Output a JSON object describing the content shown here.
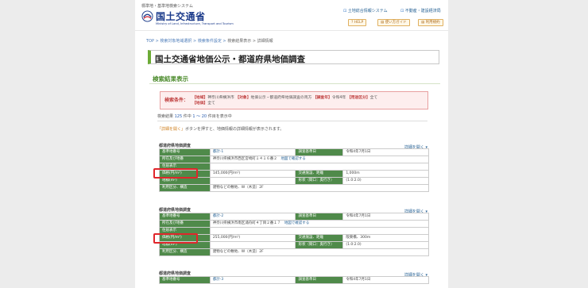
{
  "header": {
    "system_name": "標準地・基準地検索システム",
    "logo_ja": "国土交通省",
    "logo_en": "Ministry of Land, Infrastructure, Transport and Tourism",
    "links": [
      "土地総合情報システム",
      "不動産・建設経済局"
    ],
    "buttons": [
      "HELP",
      "使い方ガイド",
      "利用規約"
    ]
  },
  "breadcrumb": {
    "items": [
      "TOP",
      "検索対象地域選択",
      "検索条件設定",
      "検索結果表示"
    ],
    "current": "詳細情報",
    "separator": ">"
  },
  "page_title": "国土交通省地価公示・都道府県地価調査",
  "section_title": "検索結果表示",
  "search_condition": {
    "label": "検索条件：",
    "region_tag": "【地域】",
    "region": "神奈川県横浜市",
    "target_tag": "【対象】",
    "target": "地価公示・都道府県地価調査の両方",
    "year_tag": "【調査年】",
    "year": "令和4年",
    "use_tag": "【用途区分】",
    "use": "全て",
    "area_tag": "【地価】",
    "area": "全て"
  },
  "results": {
    "prefix": "検索結果",
    "total": "125",
    "mid": "件中",
    "range": "1 ～ 20",
    "suffix": "件目を表示中"
  },
  "note": {
    "button_label": "「詳細を開く」",
    "text": "ボタンを押すと、地価情報の詳細情報が表示されます。"
  },
  "records": [
    {
      "heading": "都道府県地価調査",
      "detail_link": "詳細を開く",
      "number_label": "基準地番号",
      "number": "都計-1",
      "date_label": "調査基準日",
      "date": "令和4年7月1日",
      "location_label": "所在及び地番",
      "location": "神奈川県横浜市西区宮崎町１４１６番２",
      "map_link": "地図で確認する",
      "residence_label": "住居表示",
      "residence": "",
      "price_label": "価格(円/m²)",
      "price": "145,000(円/m²)",
      "access_label": "交通施設、距離",
      "access": "1,000m",
      "area_label": "地積(m²)",
      "area": "",
      "zone_label": "形状（間口：奥行き）",
      "zone": "(1.0:2.0)",
      "use_label": "利用区分、構造",
      "use": "建物などの敷地、W（木造）2F"
    },
    {
      "heading": "都道府県地価調査",
      "detail_link": "詳細を開く",
      "number_label": "基準地番号",
      "number": "都計-2",
      "date_label": "調査基準日",
      "date": "令和4年7月1日",
      "location_label": "所在及び地番",
      "location": "神奈川県横浜市南区浦舟町４丁目２番１７",
      "map_link": "地図で確認する",
      "residence_label": "住居表示",
      "residence": "",
      "price_label": "価格(円/m²)",
      "price": "255,000(円/m²)",
      "access_label": "交通施設、距離",
      "access": "阪東橋、300m",
      "area_label": "地積(m²)",
      "area": "",
      "zone_label": "形状（間口：奥行き）",
      "zone": "(1.0:2.0)",
      "use_label": "利用区分、構造",
      "use": "建物などの敷地、W（木造）2F"
    },
    {
      "heading": "都道府県地価調査",
      "detail_link": "詳細を開く",
      "number_label": "基準地番号",
      "number": "都計-3",
      "date_label": "調査基準日",
      "date": "令和4年7月1日"
    }
  ],
  "colors": {
    "accent_green": "#4f8a4a",
    "title_green": "#6cab36",
    "highlight_red": "#e0262b",
    "condition_bg": "#fdeeee"
  }
}
